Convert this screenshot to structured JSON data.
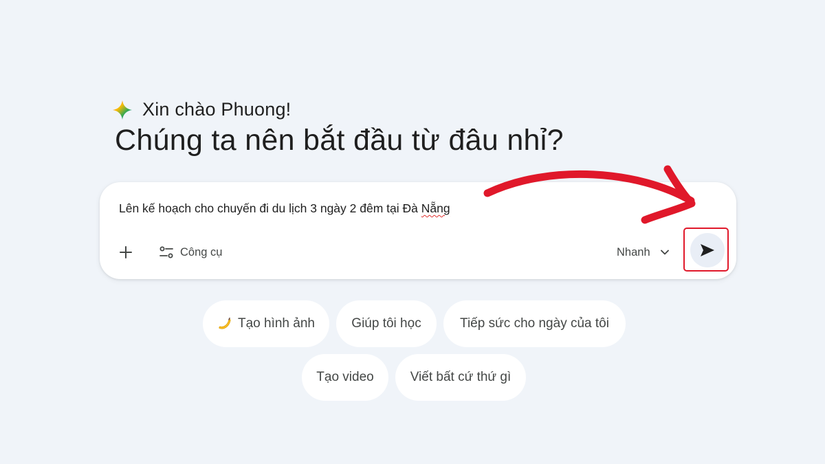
{
  "greeting": {
    "text": "Xin chào Phuong!",
    "icon": "gemini-sparkle-icon"
  },
  "headline": "Chúng ta nên bắt đầu từ đâu nhỉ?",
  "composer": {
    "prompt_before": "Lên kế hoạch cho chuyến đi du lịch 3 ngày 2 đêm tại Đà ",
    "prompt_misspelled": "Nẵng",
    "add_icon": "plus-icon",
    "tools_icon": "tune-icon",
    "tools_label": "Công cụ",
    "model_label": "Nhanh",
    "model_icon": "chevron-down-icon",
    "send_icon": "send-arrow-icon"
  },
  "chips": [
    {
      "label": "Tạo hình ảnh",
      "icon": "banana-icon"
    },
    {
      "label": "Giúp tôi học"
    },
    {
      "label": "Tiếp sức cho ngày của tôi"
    },
    {
      "label": "Tạo video"
    },
    {
      "label": "Viết bất cứ thứ gì"
    }
  ],
  "colors": {
    "background": "#f0f4f9",
    "card": "#ffffff",
    "annotation_red": "#e0182a",
    "send_button_bg": "#e9eef6",
    "text_primary": "#1f1f1f",
    "text_secondary": "#444746"
  }
}
